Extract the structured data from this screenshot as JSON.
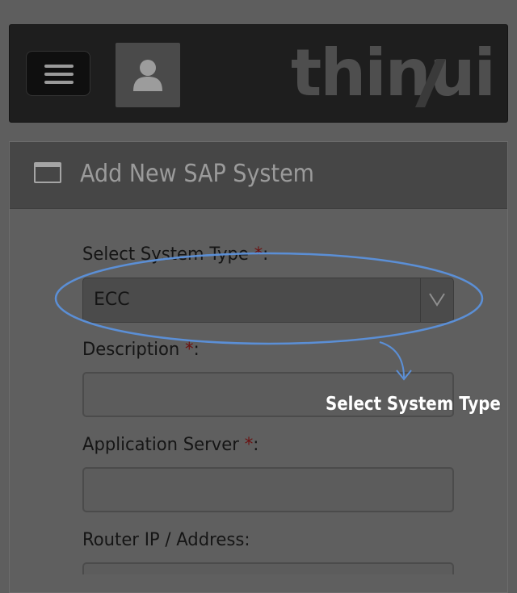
{
  "header": {
    "brand": "thinui"
  },
  "panel": {
    "title": "Add New SAP System"
  },
  "form": {
    "system_type": {
      "label": "Select System Type",
      "required_mark": "*",
      "suffix": ":",
      "value": "ECC"
    },
    "description": {
      "label": "Description",
      "required_mark": "*",
      "suffix": ":",
      "value": ""
    },
    "application_server": {
      "label": "Application Server",
      "required_mark": "*",
      "suffix": ":",
      "value": ""
    },
    "router": {
      "label": "Router IP / Address:",
      "value": ""
    }
  },
  "annotation": {
    "callout": "Select System Type",
    "color": "#5b8fd6"
  },
  "icons": {
    "menu": "hamburger-menu-icon",
    "avatar": "user-avatar-icon",
    "window": "window-icon",
    "dropdown": "chevron-down-icon"
  }
}
